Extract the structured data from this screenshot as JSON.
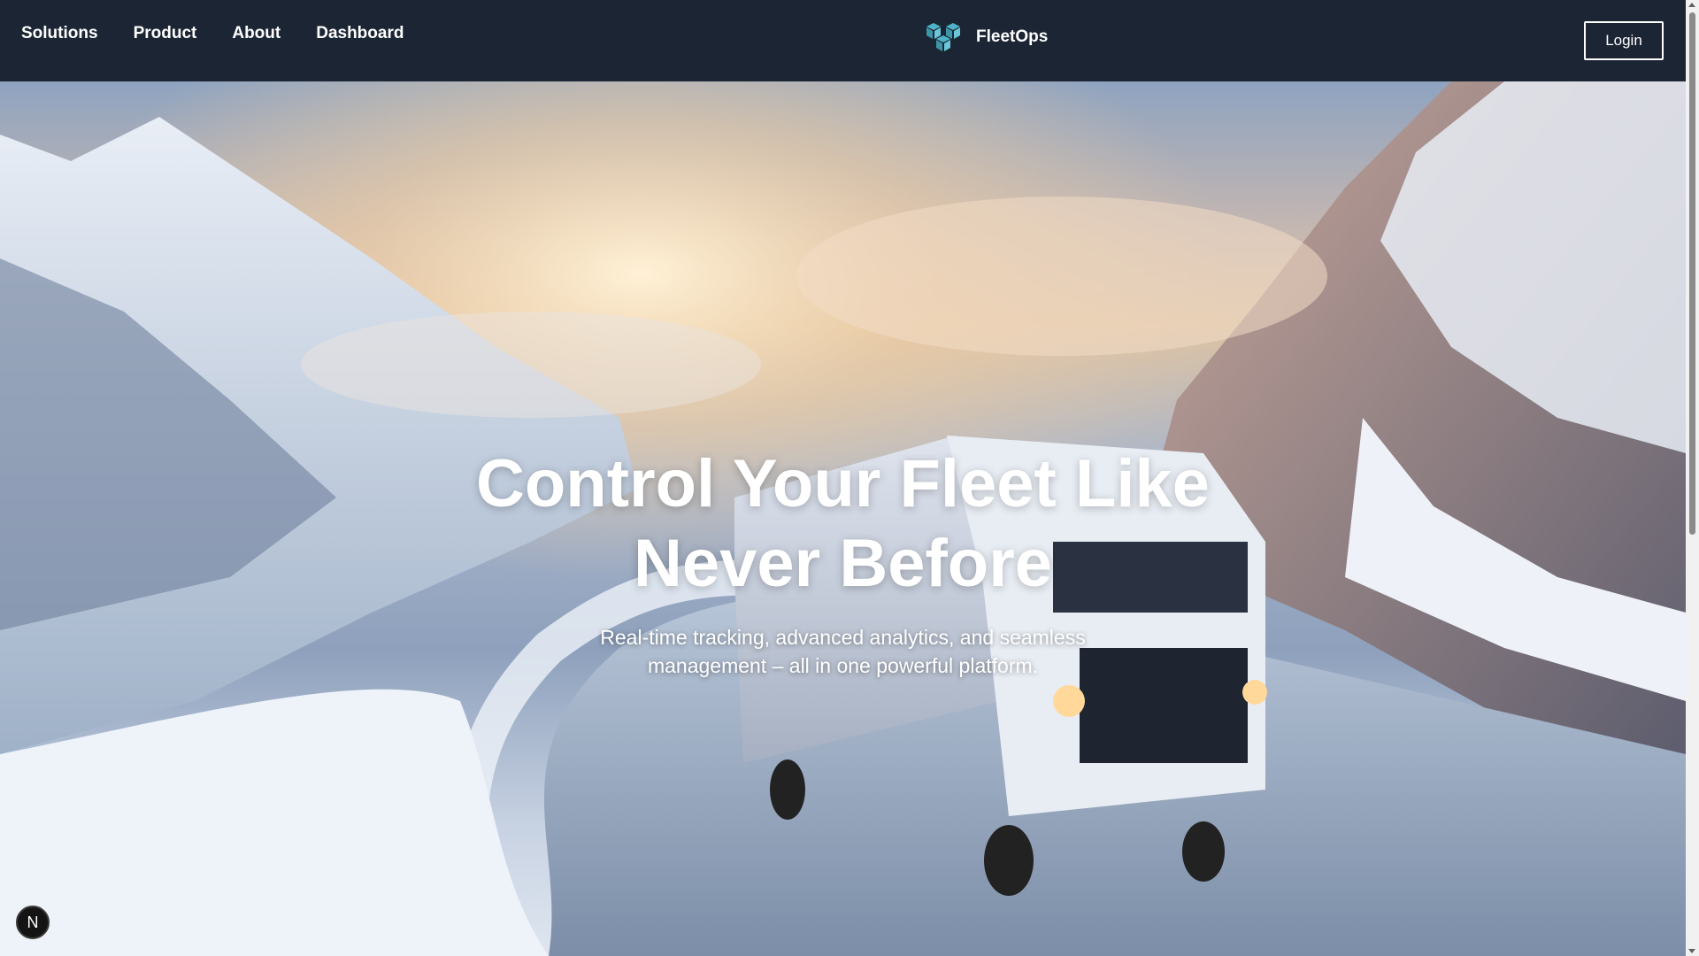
{
  "nav": {
    "items": [
      {
        "label": "Solutions"
      },
      {
        "label": "Product"
      },
      {
        "label": "About"
      },
      {
        "label": "Dashboard"
      }
    ]
  },
  "brand": {
    "name": "FleetOps",
    "logo_icon": "cubes-logo-icon",
    "logo_color": "#4fb3c8"
  },
  "login_label": "Login",
  "hero": {
    "title": "Control Your Fleet Like Never Before",
    "subtitle": "Real-time tracking, advanced analytics, and seamless management – all in one powerful platform."
  },
  "badge": {
    "letter": "N",
    "icon": "next-dev-indicator-icon"
  },
  "colors": {
    "nav_background": "#1b2533",
    "text": "#ffffff"
  }
}
